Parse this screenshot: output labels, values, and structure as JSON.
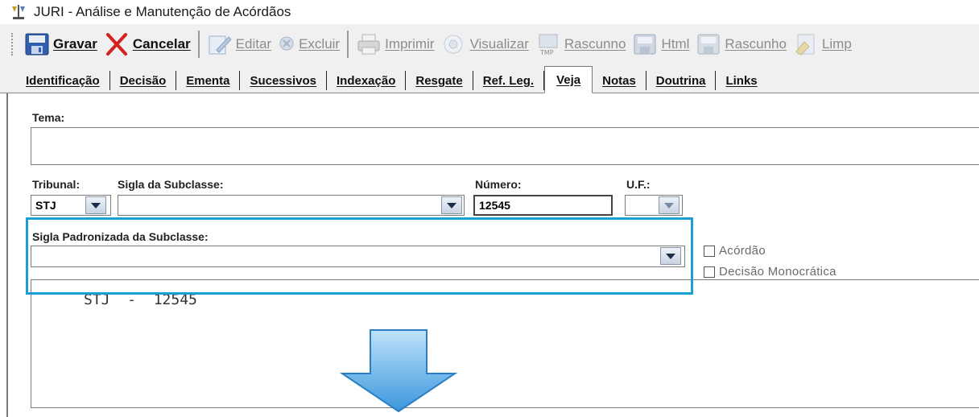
{
  "window": {
    "title": "JURI - Análise e Manutenção de Acórdãos",
    "icon": "law-app-icon"
  },
  "toolbar": {
    "buttons": [
      {
        "label": "Gravar",
        "icon": "save-icon",
        "enabled": true
      },
      {
        "label": "Cancelar",
        "icon": "cancel-x-icon",
        "enabled": true
      },
      {
        "label": "Editar",
        "icon": "edit-icon",
        "enabled": false
      },
      {
        "label": "Excluir",
        "icon": "delete-icon",
        "enabled": false
      },
      {
        "label": "Imprimir",
        "icon": "print-icon",
        "enabled": false
      },
      {
        "label": "Visualizar",
        "icon": "view-icon",
        "enabled": false
      },
      {
        "label": "Rascunno",
        "icon": "draft-tmp-icon",
        "enabled": false
      },
      {
        "label": "Html",
        "icon": "html-icon",
        "enabled": false
      },
      {
        "label": "Rascunho",
        "icon": "draft-icon",
        "enabled": false
      },
      {
        "label": "Limp",
        "icon": "clear-icon",
        "enabled": false
      }
    ]
  },
  "tabs": [
    {
      "label": "Identificação",
      "active": false
    },
    {
      "label": "Decisão",
      "active": false
    },
    {
      "label": "Ementa",
      "active": false
    },
    {
      "label": "Sucessivos",
      "active": false
    },
    {
      "label": "Indexação",
      "active": false
    },
    {
      "label": "Resgate",
      "active": false
    },
    {
      "label": "Ref. Leg.",
      "active": false
    },
    {
      "label": "Veja",
      "active": true
    },
    {
      "label": "Notas",
      "active": false
    },
    {
      "label": "Doutrina",
      "active": false
    },
    {
      "label": "Links",
      "active": false
    }
  ],
  "form": {
    "tema_label": "Tema:",
    "tema_value": "",
    "tribunal_label": "Tribunal:",
    "tribunal_value": "STJ",
    "sigla_subclasse_label": "Sigla da Subclasse:",
    "sigla_subclasse_value": "",
    "numero_label": "Número:",
    "numero_value": "12545",
    "uf_label": "U.F.:",
    "uf_value": "",
    "sigla_padronizada_label": "Sigla Padronizada da Subclasse:",
    "sigla_padronizada_value": "",
    "checkbox_acordao": "Acórdão",
    "checkbox_decisao_monocratica": "Decisão Monocrática",
    "veja_text": "STJ  -  12545"
  },
  "colors": {
    "highlight": "#1a9fd4",
    "arrow_top": "#bfe3fb",
    "arrow_bottom": "#3a97dc"
  }
}
